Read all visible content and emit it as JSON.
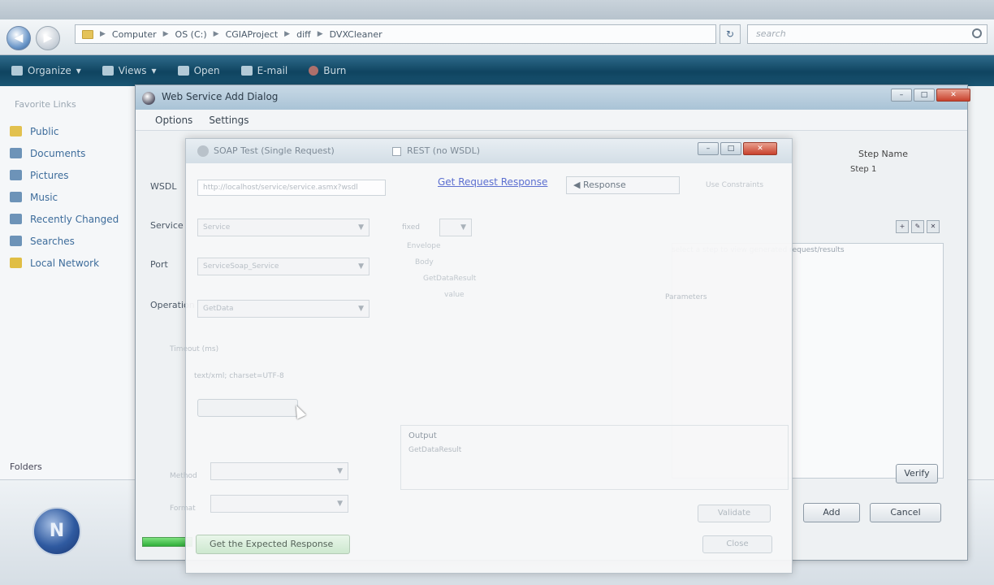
{
  "explorer": {
    "breadcrumb": [
      "Computer",
      "OS (C:)",
      "CGIAProject",
      "diff",
      "DVXCleaner"
    ],
    "search_placeholder": "search",
    "toolbar": {
      "organize": "Organize",
      "views": "Views",
      "open": "Open",
      "e_mail": "E-mail",
      "burn": "Burn"
    },
    "nav": {
      "header": "Favorite Links",
      "items": [
        "Public",
        "Documents",
        "Pictures",
        "Music",
        "Recently Changed",
        "Searches",
        "Local Network"
      ],
      "folders_label": "Folders"
    }
  },
  "dialog1": {
    "title": "Web Service Add Dialog",
    "menu": [
      "Options",
      "Settings"
    ],
    "labels": {
      "wsdl": "WSDL",
      "service": "Service",
      "port": "Port",
      "operation": "Operation"
    },
    "right_panel": {
      "step_name_header": "Step Name",
      "step_value": "Step 1",
      "results_hint": "select a step to view generated request/results"
    },
    "buttons": {
      "verify": "Verify",
      "add": "Add",
      "cancel": "Cancel"
    },
    "window": {
      "minimize": "–",
      "maximize": "□",
      "close": "✕"
    }
  },
  "dialog2": {
    "title": "SOAP Test (Single Request)",
    "checkbox_label": "REST (no WSDL)",
    "url_value": "http://localhost/service/service.asmx?wsdl",
    "link": "Get Request Response",
    "tab_label": "Response",
    "right_faint": "Use Constraints",
    "combos": {
      "service": "Service",
      "port": "ServiceSoap_Service",
      "operation": "GetData"
    },
    "small_labels": {
      "fixed": "fixed",
      "parameters": "Parameters",
      "timeout": "Timeout (ms)",
      "method": "Method",
      "format": "Format"
    },
    "value_field": "text/xml; charset=UTF-8",
    "tree": [
      "Envelope",
      "Body",
      "GetDataResult",
      "value"
    ],
    "info": {
      "label": "Output",
      "value": "GetDataResult"
    },
    "bottom": {
      "get_response": "Get the Expected Response",
      "close": "Close",
      "validate": "Validate"
    }
  },
  "os": {
    "orb_label": "N"
  }
}
